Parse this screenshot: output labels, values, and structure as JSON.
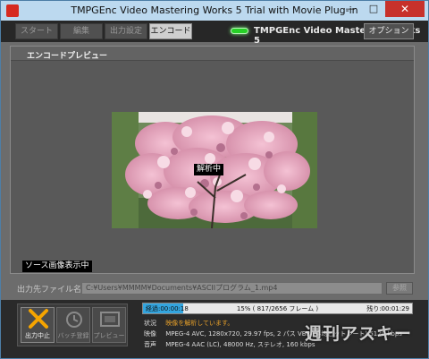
{
  "window": {
    "title": "TMPGEnc Video Mastering Works 5 Trial with Movie Plug-in"
  },
  "tabs": [
    {
      "label": "スタート"
    },
    {
      "label": "編集"
    },
    {
      "label": "出力設定"
    },
    {
      "label": "エンコード"
    }
  ],
  "brand": {
    "logo_text": "TMPGEnc Video Mastering Works 5"
  },
  "toolbar": {
    "options_label": "オプション"
  },
  "preview": {
    "title": "エンコードプレビュー",
    "overlay_label": "解析中",
    "source_button_label": "ソース画像表示中"
  },
  "output": {
    "label": "出力先ファイル名(F)",
    "path": "C:¥Users¥MMMM¥Documents¥ASCIIプログラム_1.mp4",
    "browse_label": "参照"
  },
  "actions": {
    "stop_label": "出力中止",
    "batch_label": "バッチ登録",
    "preview_label": "プレビュー"
  },
  "progress": {
    "elapsed": "経過:00:00:18",
    "percent_text": "15% ( 817/2656 フレーム )",
    "remaining": "残り:00:01:29",
    "fraction": 0.15
  },
  "info": {
    "status_key": "状況",
    "status_value": "映像を解析しています。",
    "video_key": "映像",
    "video_value": "MPEG-4 AVC, 1280x720, 29.97 fps, 2 パス VBR (平均ビットレート) 5120 kbps",
    "audio_key": "音声",
    "audio_value": "MPEG-4 AAC (LC), 48000 Hz, ステレオ, 160 kbps"
  },
  "watermark": "週刊アスキー",
  "colors": {
    "accent": "#33a5df",
    "warn": "#e8a12a",
    "stop": "#f5a400",
    "led": "#27d027"
  }
}
